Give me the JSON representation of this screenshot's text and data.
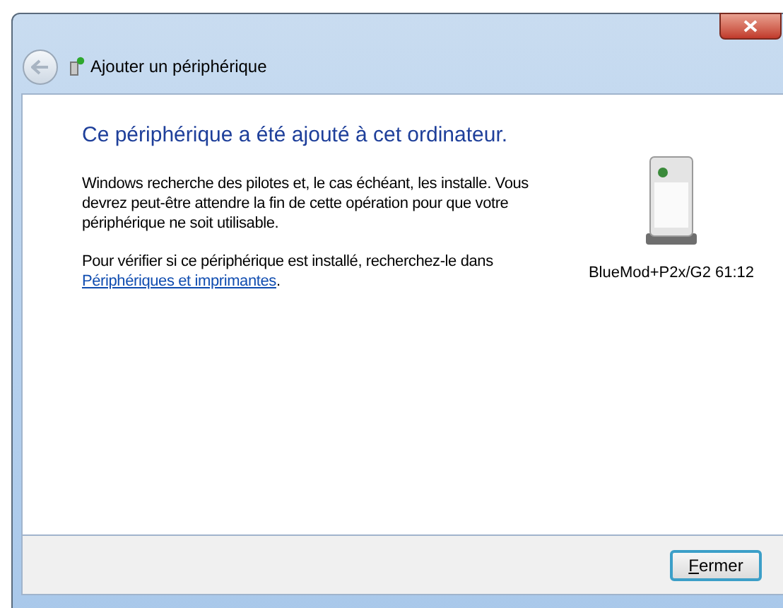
{
  "window": {
    "title": "Ajouter un périphérique"
  },
  "heading": "Ce périphérique a été ajouté à cet ordinateur.",
  "paragraphs": [
    "Windows recherche des pilotes et, le cas échéant, les installe. Vous devrez peut-être attendre la fin de cette opération pour que votre périphérique ne soit utilisable."
  ],
  "check_text": "Pour vérifier si ce périphérique est installé, recherchez-le dans",
  "link": "Périphériques et imprimantes",
  "link_suffix": ".",
  "device": {
    "name": "BlueMod+P2x/G2 61:12"
  },
  "buttons": [
    {
      "label": "Fermer",
      "kind": "default"
    }
  ]
}
